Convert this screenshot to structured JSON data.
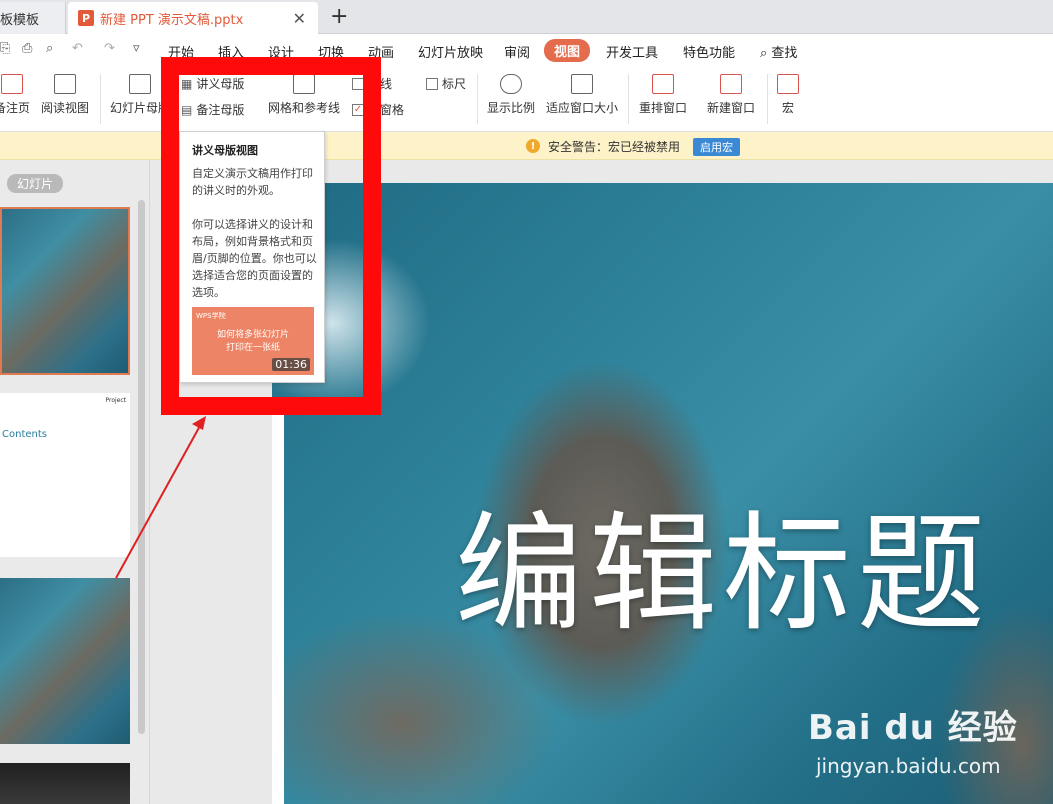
{
  "tabs": {
    "left_tab": "板模板",
    "active_tab": "新建 PPT 演示文稿.pptx",
    "ppt_icon": "P",
    "close": "✕",
    "new_tab": "+"
  },
  "menu": {
    "items": [
      "开始",
      "插入",
      "设计",
      "切换",
      "动画",
      "幻灯片放映",
      "审阅",
      "视图",
      "开发工具",
      "特色功能"
    ],
    "active": "视图",
    "search": "查找"
  },
  "ribbon": {
    "notes_page": "备注页",
    "reading_view": "阅读视图",
    "slide_master": "幻灯片母版",
    "handout_master": "讲义母版",
    "notes_master": "备注母版",
    "grid_guides": "网格和参考线",
    "gridlines_partial": "格线",
    "taskpane_partial": "务窗格",
    "ruler": "标尺",
    "zoom": "显示比例",
    "fit_window": "适应窗口大小",
    "arrange": "重排窗口",
    "new_window": "新建窗口",
    "macro": "宏"
  },
  "security": {
    "message": "安全警告：宏已经被禁用",
    "enable_button": "启用宏",
    "warn_glyph": "!"
  },
  "left_panel": {
    "slide_label": "幻灯片",
    "thumb_contents": "Contents",
    "thumb_project": "Project"
  },
  "tooltip": {
    "title": "讲义母版视图",
    "para1": "自定义演示文稿用作打印的讲义时的外观。",
    "para2": "你可以选择讲义的设计和布局，例如背景格式和页眉/页脚的位置。你也可以选择适合您的页面设置的选项。",
    "video_logo": "WPS学院",
    "video_line1": "如何将多张幻灯片",
    "video_line2": "打印在一张纸",
    "video_duration": "01:36"
  },
  "slide": {
    "title": "编辑标题"
  },
  "watermark": {
    "brand": "Bai du 经验",
    "site": "jingyan.baidu.com"
  },
  "colors": {
    "accent": "#e46c4c",
    "annotation_red": "#ff0a0a",
    "security_bg": "#fdf2c8",
    "enable_blue": "#3b88d4"
  }
}
